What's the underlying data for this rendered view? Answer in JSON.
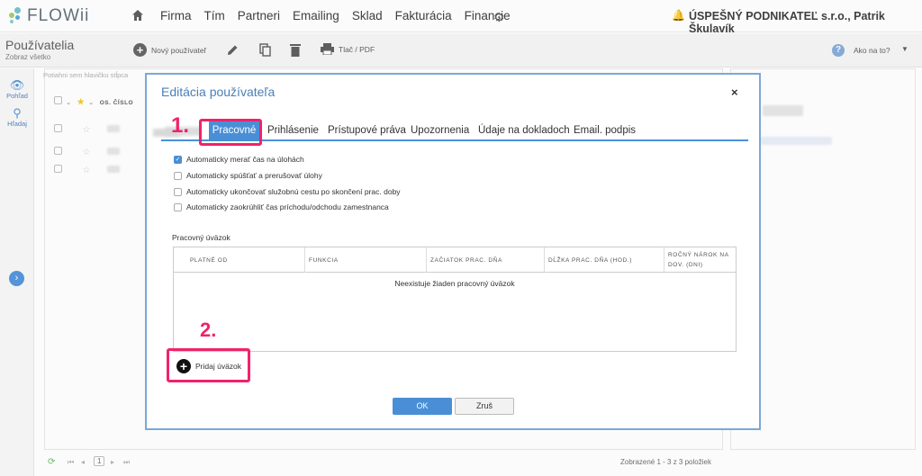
{
  "app": {
    "brand": "FLOWii"
  },
  "nav": {
    "items": [
      "Firma",
      "Tím",
      "Partneri",
      "Emailing",
      "Sklad",
      "Fakturácia",
      "Financie"
    ],
    "company": "ÚSPEŠNÝ PODNIKATEĽ s.r.o., Patrik Škulavík"
  },
  "page": {
    "title": "Používatelia",
    "subtitle": "Zobraz všetko",
    "new_user": "Nový používateľ",
    "print": "Tlač / PDF",
    "help": "Ako na to?"
  },
  "sidebar": {
    "view": "Pohľad",
    "search": "Hľadaj"
  },
  "list": {
    "search_placeholder": "Potiahni sem hlavičku stĺpca",
    "col_number": "OS. ČÍSLO",
    "footer": "Zobrazené 1 - 3 z 3 položiek",
    "page": "1"
  },
  "modal": {
    "title": "Editácia používateľa",
    "close": "×",
    "tabs": [
      "Pracovné",
      "Prihlásenie",
      "Prístupové práva",
      "Upozornenia",
      "Údaje na dokladoch",
      "Email. podpis"
    ],
    "options": [
      {
        "label": "Automaticky merať čas na úlohách",
        "checked": true
      },
      {
        "label": "Automaticky spúšťať a prerušovať úlohy",
        "checked": false
      },
      {
        "label": "Automaticky ukončovať služobnú cestu po skončení prac. doby",
        "checked": false
      },
      {
        "label": "Automaticky zaokrúhliť čas príchodu/odchodu zamestnanca",
        "checked": false
      }
    ],
    "section_label": "Pracovný úväzok",
    "table_headers": [
      "PLATNÉ OD",
      "FUNKCIA",
      "ZAČIATOK PRAC. DŇA",
      "DĹŽKA PRAC. DŇA (HOD.)",
      "ROČNÝ NÁROK NA",
      "DOV. (DNI)"
    ],
    "table_empty": "Neexistuje žiaden pracovný úväzok",
    "add_label": "Pridaj úväzok",
    "ok": "OK",
    "cancel": "Zruš"
  },
  "annotations": {
    "step1": "1.",
    "step2": "2.",
    "color": "#f0226b"
  }
}
